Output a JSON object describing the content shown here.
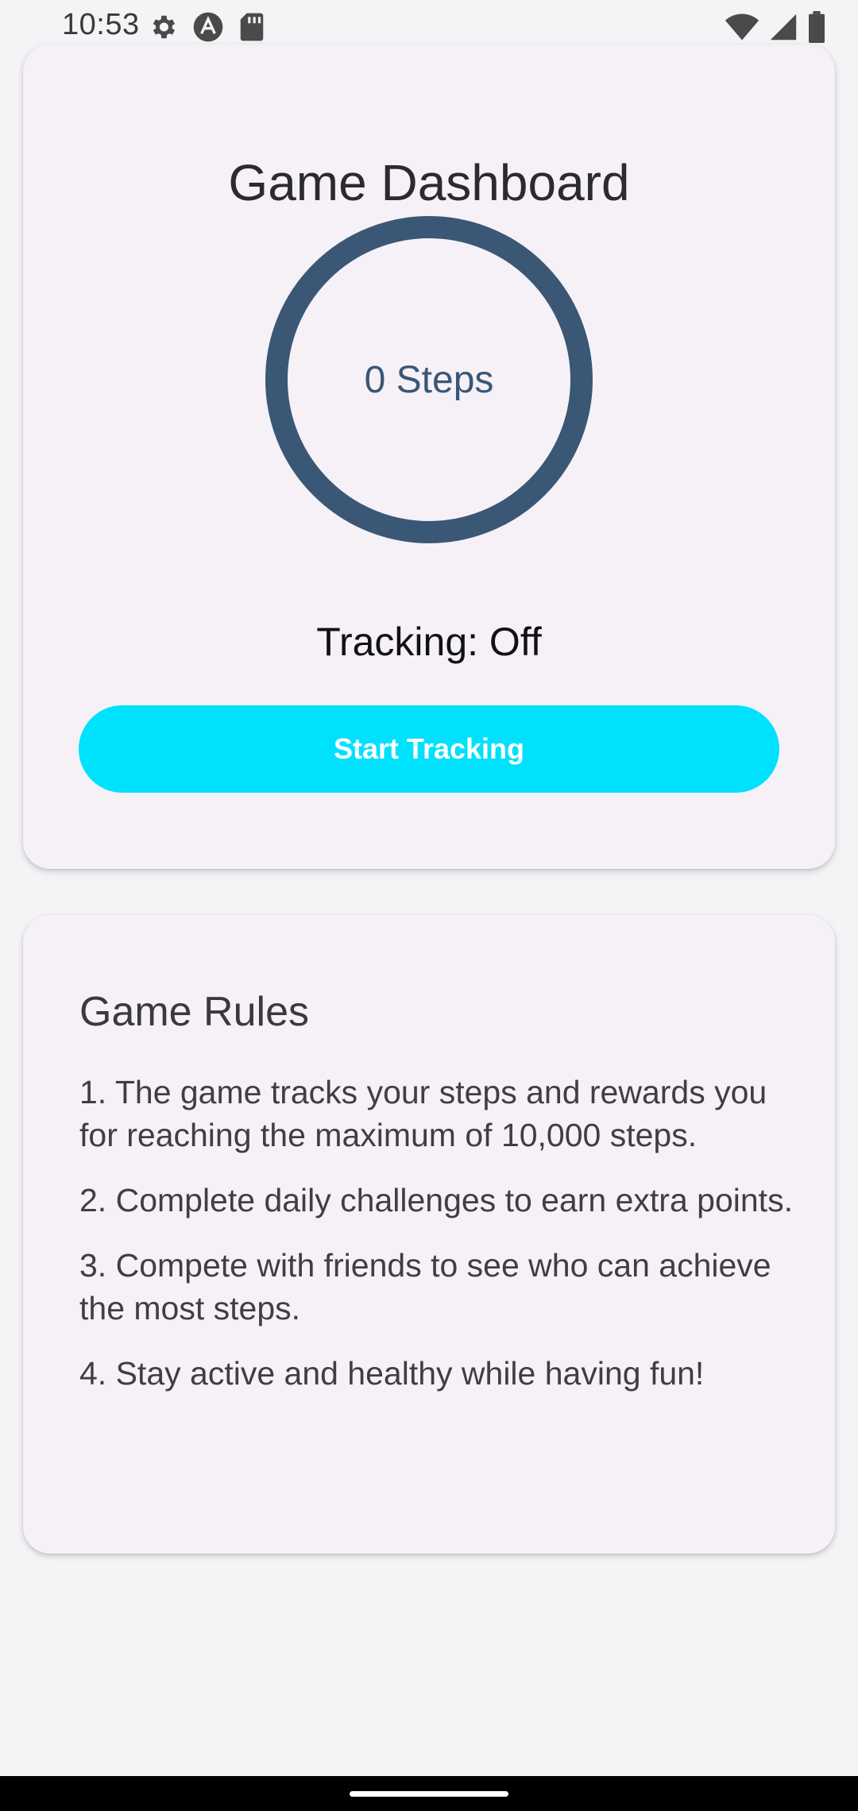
{
  "status_bar": {
    "time": "10:53",
    "left_icons": [
      "settings-icon",
      "app-icon",
      "sd-card-icon"
    ],
    "right_icons": [
      "wifi-icon",
      "signal-icon",
      "battery-icon"
    ]
  },
  "dashboard": {
    "title": "Game Dashboard",
    "steps_label": "0 Steps",
    "ring_color": "#3a5775",
    "tracking_status": "Tracking: Off",
    "start_button_label": "Start Tracking",
    "button_color": "#00e1fd"
  },
  "rules": {
    "title": "Game Rules",
    "items": [
      "1. The game tracks your steps and rewards you for reaching the maximum of 10,000 steps.",
      "2. Complete daily challenges to earn extra points.",
      "3. Compete with friends to see who can achieve the most steps.",
      "4. Stay active and healthy while having fun!"
    ]
  }
}
